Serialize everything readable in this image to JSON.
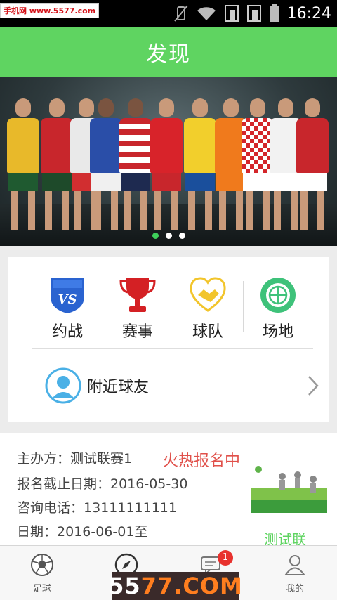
{
  "statusbar": {
    "watermark": "手机网 www.5577.com",
    "time": "16:24"
  },
  "header": {
    "title": "发现"
  },
  "banner": {
    "slide_count": 3,
    "active_index": 0
  },
  "categories": [
    {
      "label": "约战",
      "icon": "vs-shield-icon",
      "icon_text": "VS",
      "color": "#2a63d0"
    },
    {
      "label": "赛事",
      "icon": "trophy-icon",
      "color": "#d42024"
    },
    {
      "label": "球队",
      "icon": "handshake-heart-icon",
      "color": "#f2c52c"
    },
    {
      "label": "场地",
      "icon": "basketball-icon",
      "color": "#3ec27a"
    }
  ],
  "nearby": {
    "label": "附近球友"
  },
  "event": {
    "organizer": "主办方：测试联赛1",
    "status": "火热报名中",
    "deadline": "报名截止日期：2016-05-30",
    "phone": "咨询电话：13111111111",
    "date": "日期：2016-06-01至",
    "more": "测试联"
  },
  "tabbar": [
    {
      "label": "足球",
      "icon": "soccer-ball-icon"
    },
    {
      "label": "",
      "icon": "compass-icon"
    },
    {
      "label": "",
      "icon": "message-icon",
      "badge": "1"
    },
    {
      "label": "我的",
      "icon": "user-icon"
    }
  ],
  "watermark_bottom": {
    "part1": "55",
    "part2": "77.COM"
  },
  "colors": {
    "accent": "#5fd461",
    "hot": "#e0504a",
    "badge": "#e8322e"
  }
}
